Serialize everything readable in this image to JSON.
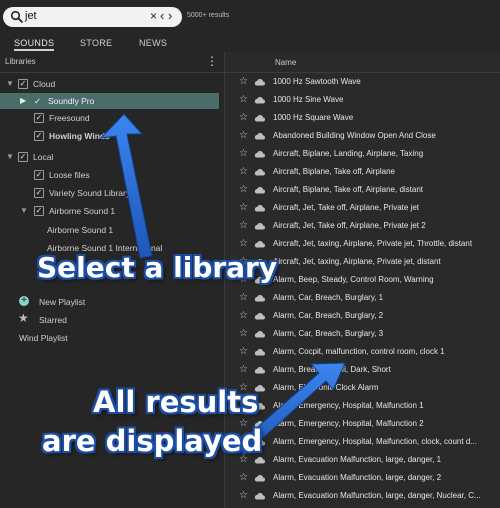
{
  "search": {
    "query": "jet",
    "clear_glyph": "×",
    "nav_glyph": "‹ ›",
    "result_count": "5000+ results"
  },
  "tabs": [
    {
      "label": "SOUNDS",
      "active": true
    },
    {
      "label": "STORE",
      "active": false
    },
    {
      "label": "NEWS",
      "active": false
    }
  ],
  "sidebar": {
    "header": "Libraries",
    "menu_icon": "kebab-menu-icon",
    "tree": [
      {
        "label": "Cloud",
        "level": 0,
        "expanded": true,
        "checked": true
      },
      {
        "label": "Soundly Pro",
        "level": 1,
        "expanded": false,
        "checked": true,
        "selected": true
      },
      {
        "label": "Freesound",
        "level": 1,
        "checked": true
      },
      {
        "label": "Howling Winds",
        "level": 1,
        "checked": true
      },
      {
        "label": "Local",
        "level": 0,
        "expanded": true,
        "checked": true
      },
      {
        "label": "Loose files",
        "level": 1,
        "checked": true
      },
      {
        "label": "Variety Sound Library",
        "level": 1,
        "checked": true
      },
      {
        "label": "Airborne Sound 1",
        "level": 1,
        "expanded": true,
        "checked": true
      },
      {
        "label": "Airborne Sound 1",
        "level": 2
      },
      {
        "label": "Airborne Sound 1 International",
        "level": 2
      }
    ],
    "playlists": {
      "new_label": "New Playlist",
      "starred_label": "Starred",
      "wind_label": "Wind Playlist"
    }
  },
  "main": {
    "column_header": "Name",
    "rows": [
      "1000 Hz Sawtooth Wave",
      "1000 Hz Sine Wave",
      "1000 Hz Square Wave",
      "Abandoned Building Window Open And Close",
      "Aircraft, Biplane, Landing, Airplane, Taxing",
      "Aircraft, Biplane, Take off, Airplane",
      "Aircraft, Biplane, Take off, Airplane, distant",
      "Aircraft, Jet, Take off, Airplane, Private jet",
      "Aircraft, Jet, Take off, Airplane, Private jet 2",
      "Aircraft, Jet, taxing, Airplane, Private jet, Throttle, distant",
      "Aircraft, Jet, taxing, Airplane, Private jet, distant",
      "Alarm, Beep, Steady, Control Room, Warning",
      "Alarm, Car, Breach, Burglary, 1",
      "Alarm, Car, Breach, Burglary, 2",
      "Alarm, Car, Breach, Burglary, 3",
      "Alarm, Cocpit, malfunction, control room, clock 1",
      "Alarm, Breach, Sci-fi, Dark, Short",
      "Alarm, Electronic Clock Alarm",
      "Alarm, Emergency, Hospital, Malfunction 1",
      "Alarm, Emergency, Hospital, Malfunction 2",
      "Alarm, Emergency, Hospital, Malfunction, clock, count d...",
      "Alarm, Evacuation Malfunction, large, danger, 1",
      "Alarm, Evacuation Malfunction, large, danger, 2",
      "Alarm, Evacuation Malfunction, large, danger, Nuclear, C..."
    ]
  },
  "annotations": {
    "select_library": "Select a library",
    "all_results_line1": "All results",
    "all_results_line2": "are displayed",
    "arrow_color": "#2f6fd8"
  },
  "colors": {
    "selected_row": "#4b6d6a",
    "accent_teal": "#8fd3c5"
  }
}
